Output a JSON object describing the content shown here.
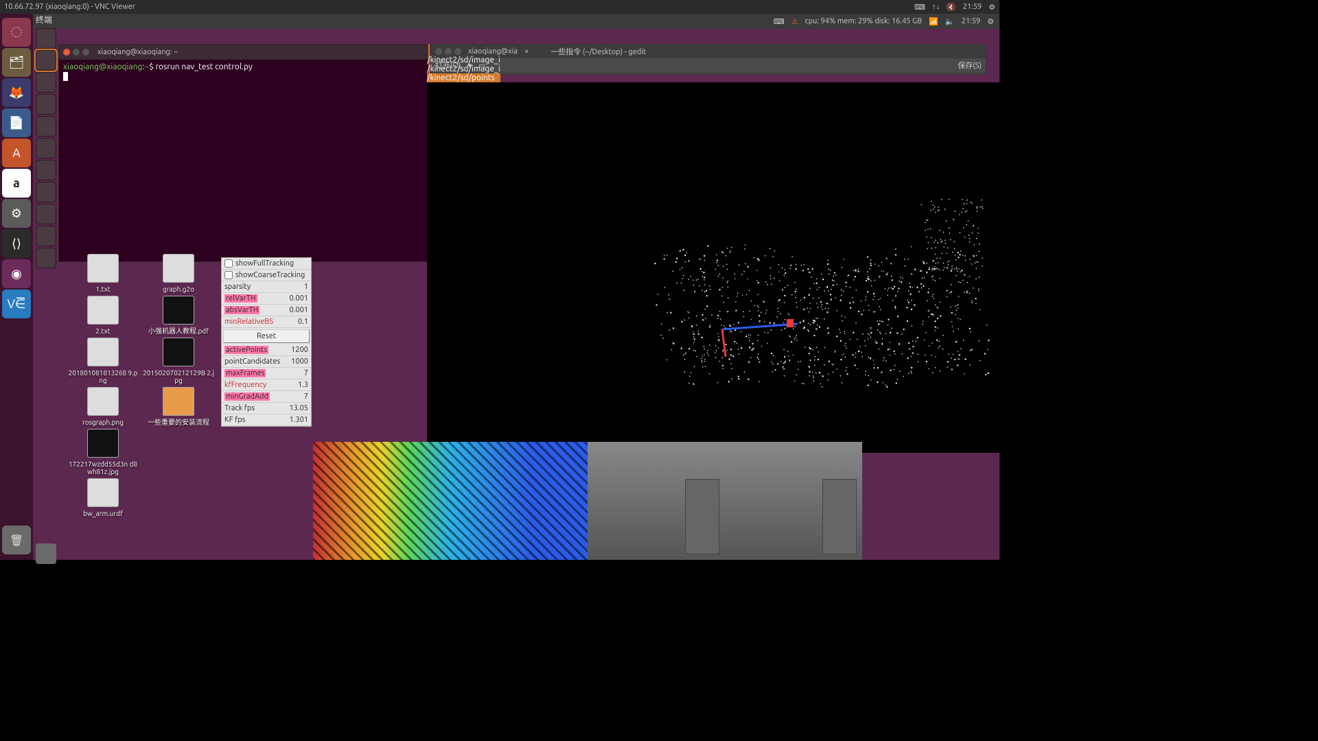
{
  "vnc": {
    "title": "10.66.72.97 (xiaoqiang:0) - VNC Viewer",
    "time": "21:59"
  },
  "outer_panel": {
    "menu": "终端",
    "cpu_mem": "cpu: 94% mem: 29% disk: 16.45 GB",
    "time": "21:59"
  },
  "inner_panel": {
    "time": "21:59"
  },
  "terminal": {
    "title": "xiaoqiang@xiaoqiang: ~",
    "user": "xiaoqiang@xiaoqiang",
    "path": "~",
    "command": "rosrun nav_test control.py"
  },
  "gedit": {
    "tab": "xiaoqiang@xia",
    "title": "一些指令 (~/Desktop) - gedit",
    "open": "打开(O)",
    "save": "保存(S)"
  },
  "paths": {
    "p1": "/kinect2/sd/image_i",
    "p2": "/kinect2/sd/image_i",
    "p3": "/kinect2/sd/points"
  },
  "desktop": {
    "items_a": [
      {
        "label": "1.txt"
      },
      {
        "label": "2.txt"
      },
      {
        "label": "201801081813268\n9.png"
      },
      {
        "label": "rosgraph.png"
      },
      {
        "label": "172217wzdd55d3n\nd8wh81z.jpg"
      },
      {
        "label": "bw_arm.urdf"
      }
    ],
    "items_b": [
      {
        "label": "graph.g2o"
      },
      {
        "label": "小强机器人教程.pdf"
      },
      {
        "label": "201502070212129B\n2.jpg"
      },
      {
        "label": "一些重要的安装流程"
      }
    ]
  },
  "panel": {
    "showFullTracking": "showFullTracking",
    "showCoarseTracking": "showCoarseTracking",
    "rows": [
      {
        "name": "sparsity",
        "val": "1",
        "cls": ""
      },
      {
        "name": "relVarTH",
        "val": "0.001",
        "cls": "hl"
      },
      {
        "name": "absVarTH",
        "val": "0.001",
        "cls": "hl"
      },
      {
        "name": "minRelativeBS",
        "val": "0.1",
        "cls": "red"
      }
    ],
    "reset": "Reset",
    "rows2": [
      {
        "name": "activePoints",
        "val": "1200",
        "cls": "hl"
      },
      {
        "name": "pointCandidates",
        "val": "1000",
        "cls": ""
      },
      {
        "name": "maxFrames",
        "val": "7",
        "cls": "hl"
      },
      {
        "name": "kfFrequency",
        "val": "1.3",
        "cls": "red"
      },
      {
        "name": "minGradAdd",
        "val": "7",
        "cls": "hl"
      }
    ],
    "stats": [
      {
        "name": "Track fps",
        "val": "13.05"
      },
      {
        "name": "KF fps",
        "val": "1.301"
      }
    ]
  }
}
